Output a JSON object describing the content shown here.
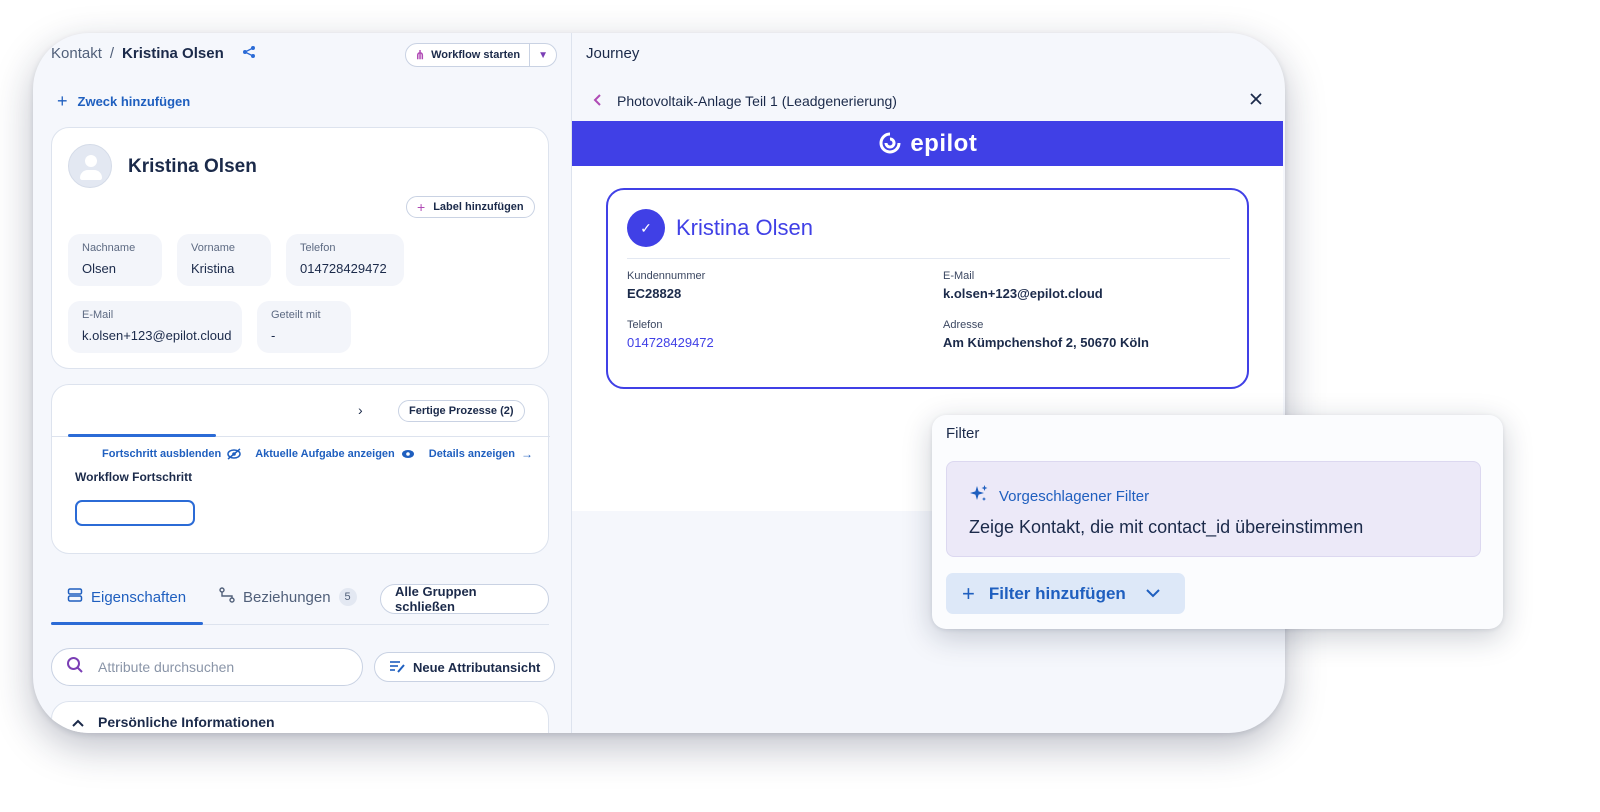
{
  "left": {
    "breadcrumb": {
      "root": "Kontakt",
      "sep": "/",
      "current": "Kristina Olsen"
    },
    "workflow_button": {
      "label": "Workflow starten"
    },
    "add_purpose": "Zweck hinzufügen",
    "profile": {
      "name": "Kristina Olsen",
      "label_button": "Label hinzufügen",
      "fields": [
        {
          "label": "Nachname",
          "value": "Olsen"
        },
        {
          "label": "Vorname",
          "value": "Kristina"
        },
        {
          "label": "Telefon",
          "value": "014728429472"
        },
        {
          "label": "E-Mail",
          "value": "k.olsen+123@epilot.cloud"
        },
        {
          "label": "Geteilt mit",
          "value": "-"
        }
      ]
    },
    "process": {
      "finished_button": "Fertige Prozesse (2)",
      "actions": {
        "hide_progress": "Fortschritt ausblenden",
        "show_task": "Aktuelle Aufgabe anzeigen",
        "show_details": "Details anzeigen"
      },
      "title": "Workflow Fortschritt"
    },
    "tabs": {
      "properties": "Eigenschaften",
      "relations": "Beziehungen",
      "relations_count": "5",
      "close_all": "Alle Gruppen schließen"
    },
    "search": {
      "placeholder": "Attribute durchsuchen"
    },
    "new_view": "Neue Attributansicht",
    "section_title": "Persönliche Informationen"
  },
  "right": {
    "title": "Journey",
    "journey_name": "Photovoltaik-Anlage Teil 1 (Leadgenerierung)",
    "brand": "epilot",
    "customer_card": {
      "name": "Kristina Olsen",
      "customer_number_label": "Kundennummer",
      "customer_number": "EC28828",
      "email_label": "E-Mail",
      "email": "k.olsen+123@epilot.cloud",
      "phone_label": "Telefon",
      "phone": "014728429472",
      "address_label": "Adresse",
      "address": "Am Kümpchenshof 2, 50670 Köln"
    }
  },
  "filter": {
    "title": "Filter",
    "suggested_title": "Vorgeschlagener Filter",
    "suggested_text": "Zeige Kontakt, die mit contact_id übereinstimmen",
    "add_button": "Filter hinzufügen"
  },
  "colors": {
    "accent": "#4040e6",
    "link": "#1f5fbf",
    "magenta": "#b04bb5"
  }
}
